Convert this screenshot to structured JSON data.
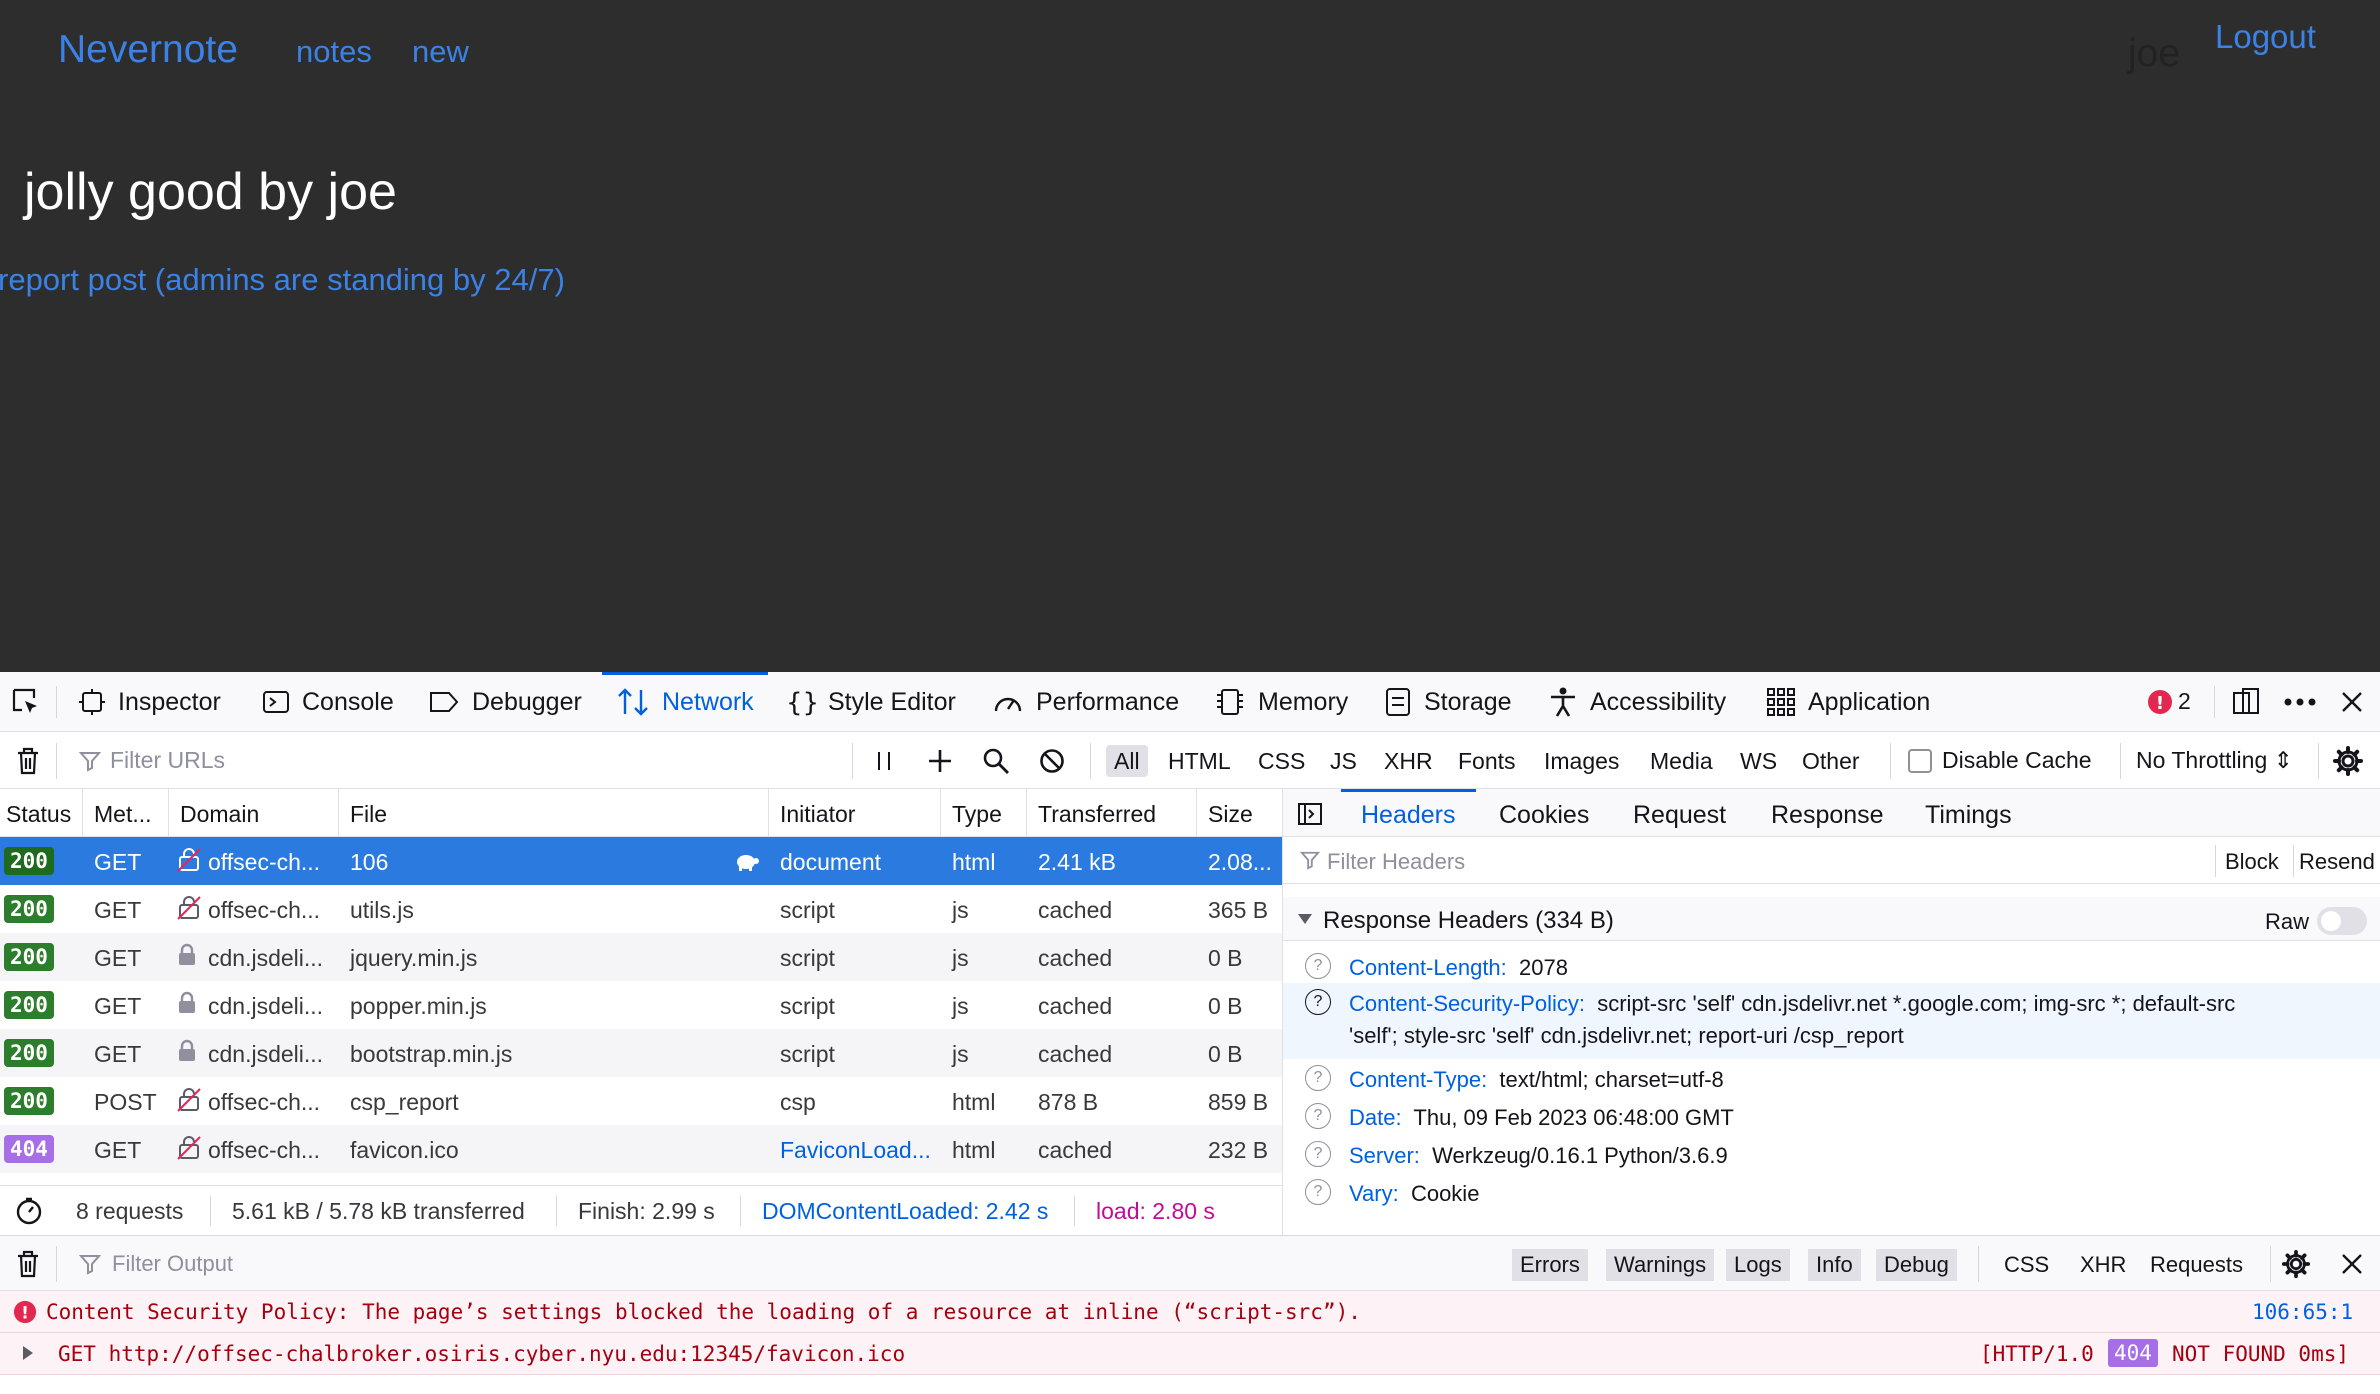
{
  "site": {
    "brand": "Nevernote",
    "nav": [
      "notes",
      "new"
    ],
    "user": "joe",
    "logout": "Logout",
    "post_title": "jolly good by joe",
    "report_link": "report post (admins are standing by 24/7)"
  },
  "devtools": {
    "tabs": [
      "Inspector",
      "Console",
      "Debugger",
      "Network",
      "Style Editor",
      "Performance",
      "Memory",
      "Storage",
      "Accessibility",
      "Application"
    ],
    "active_tab": "Network",
    "error_count": "2",
    "filter_placeholder": "Filter URLs",
    "type_filters": [
      "All",
      "HTML",
      "CSS",
      "JS",
      "XHR",
      "Fonts",
      "Images",
      "Media",
      "WS",
      "Other"
    ],
    "disable_cache": "Disable Cache",
    "throttling": "No Throttling ⇕",
    "columns": [
      "Status",
      "Met...",
      "Domain",
      "File",
      "Initiator",
      "Type",
      "Transferred",
      "Size"
    ],
    "requests": [
      {
        "status": "200",
        "method": "GET",
        "domain": "offsec-ch...",
        "file": "106",
        "initiator": "document",
        "type": "html",
        "transferred": "2.41 kB",
        "size": "2.08..."
      },
      {
        "status": "200",
        "method": "GET",
        "domain": "offsec-ch...",
        "file": "utils.js",
        "initiator": "script",
        "type": "js",
        "transferred": "cached",
        "size": "365 B"
      },
      {
        "status": "200",
        "method": "GET",
        "domain": "cdn.jsdeli...",
        "file": "jquery.min.js",
        "initiator": "script",
        "type": "js",
        "transferred": "cached",
        "size": "0 B"
      },
      {
        "status": "200",
        "method": "GET",
        "domain": "cdn.jsdeli...",
        "file": "popper.min.js",
        "initiator": "script",
        "type": "js",
        "transferred": "cached",
        "size": "0 B"
      },
      {
        "status": "200",
        "method": "GET",
        "domain": "cdn.jsdeli...",
        "file": "bootstrap.min.js",
        "initiator": "script",
        "type": "js",
        "transferred": "cached",
        "size": "0 B"
      },
      {
        "status": "200",
        "method": "POST",
        "domain": "offsec-ch...",
        "file": "csp_report",
        "initiator": "csp",
        "type": "html",
        "transferred": "878 B",
        "size": "859 B"
      },
      {
        "status": "404",
        "method": "GET",
        "domain": "offsec-ch...",
        "file": "favicon.ico",
        "initiator": "FaviconLoad...",
        "type": "html",
        "transferred": "cached",
        "size": "232 B"
      }
    ],
    "summary": {
      "requests": "8 requests",
      "transferred": "5.61 kB / 5.78 kB transferred",
      "finish": "Finish: 2.99 s",
      "dcl": "DOMContentLoaded: 2.42 s",
      "load": "load: 2.80 s"
    },
    "panel_tabs": [
      "Headers",
      "Cookies",
      "Request",
      "Response",
      "Timings"
    ],
    "filter_headers": "Filter Headers",
    "block": "Block",
    "resend": "Resend",
    "response_headers_title": "Response Headers (334 B)",
    "raw": "Raw",
    "headers": [
      {
        "name": "Content-Length:",
        "value": "2078"
      },
      {
        "name": "Content-Security-Policy:",
        "value": "script-src 'self' cdn.jsdelivr.net *.google.com; img-src *; default-src",
        "value2": "'self'; style-src 'self' cdn.jsdelivr.net; report-uri /csp_report"
      },
      {
        "name": "Content-Type:",
        "value": "text/html; charset=utf-8"
      },
      {
        "name": "Date:",
        "value": "Thu, 09 Feb 2023 06:48:00 GMT"
      },
      {
        "name": "Server:",
        "value": "Werkzeug/0.16.1 Python/3.6.9"
      },
      {
        "name": "Vary:",
        "value": "Cookie"
      }
    ],
    "console": {
      "filter_placeholder": "Filter Output",
      "levels": [
        "Errors",
        "Warnings",
        "Logs",
        "Info",
        "Debug"
      ],
      "extra": [
        "CSS",
        "XHR",
        "Requests"
      ],
      "messages": [
        {
          "text": "Content Security Policy: The page’s settings blocked the loading of a resource at inline (“script-src”).",
          "location": "106:65:1"
        },
        {
          "text": "GET http://offsec-chalbroker.osiris.cyber.nyu.edu:12345/favicon.ico",
          "proto": "[HTTP/1.0",
          "code": "404",
          "rest": "NOT FOUND 0ms]"
        }
      ]
    }
  }
}
